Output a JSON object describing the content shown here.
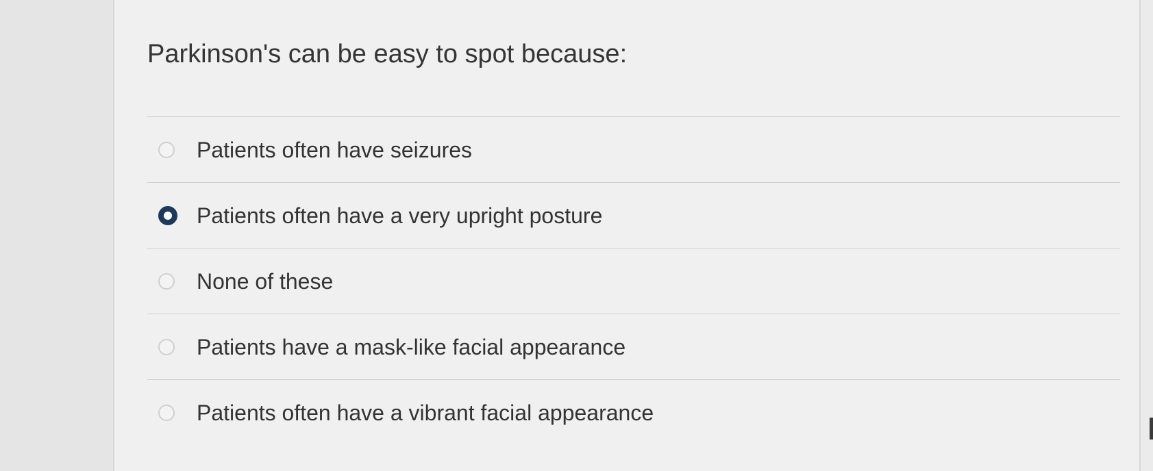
{
  "question": {
    "title": "Parkinson's can be easy to spot because:"
  },
  "options": [
    {
      "label": "Patients often have seizures",
      "selected": false
    },
    {
      "label": "Patients often have a very upright posture",
      "selected": true
    },
    {
      "label": "None of these",
      "selected": false
    },
    {
      "label": "Patients have a mask-like facial appearance",
      "selected": false
    },
    {
      "label": "Patients often have a vibrant facial appearance",
      "selected": false
    }
  ],
  "colors": {
    "selected_radio": "#1d3a5b",
    "text": "#333333",
    "divider": "#cfcfcf",
    "background": "#f1f0f0"
  }
}
